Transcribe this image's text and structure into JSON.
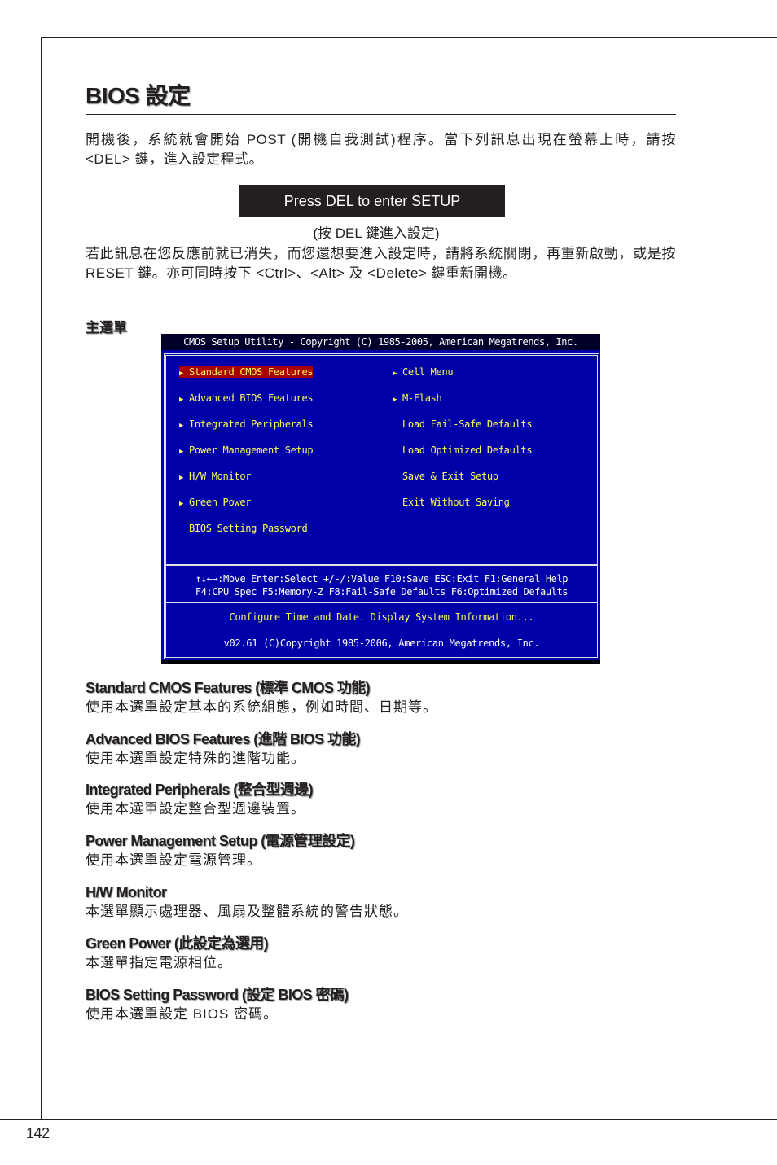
{
  "page": {
    "title": "BIOS 設定",
    "page_number": "142"
  },
  "intro": {
    "paragraph1": "開機後，系統就會開始 POST (開機自我測試)程序。當下列訊息出現在螢幕上時，請按 <DEL> 鍵，進入設定程式。",
    "press_box": "Press DEL to enter SETUP",
    "press_caption": "(按 DEL 鍵進入設定)",
    "paragraph2": "若此訊息在您反應前就已消失，而您還想要進入設定時，請將系統關閉，再重新啟動，或是按 RESET 鍵。亦可同時按下 <Ctrl>、<Alt> 及 <Delete> 鍵重新開機。"
  },
  "main_menu_heading": "主選單",
  "bios_screen": {
    "title": "CMOS Setup Utility - Copyright (C) 1985-2005, American Megatrends, Inc.",
    "left_items": [
      {
        "label": "Standard CMOS Features",
        "arrow": "▶",
        "selected": true
      },
      {
        "label": "Advanced BIOS Features",
        "arrow": "▶"
      },
      {
        "label": "Integrated Peripherals",
        "arrow": "▶"
      },
      {
        "label": "Power Management Setup",
        "arrow": "▶"
      },
      {
        "label": "H/W Monitor",
        "arrow": "▶"
      },
      {
        "label": "Green Power",
        "arrow": "▶"
      },
      {
        "label": "BIOS Setting Password",
        "arrow": ""
      }
    ],
    "right_items": [
      {
        "label": "Cell Menu",
        "arrow": "▶"
      },
      {
        "label": "M-Flash",
        "arrow": "▶"
      },
      {
        "label": "Load Fail-Safe Defaults",
        "arrow": ""
      },
      {
        "label": "Load Optimized Defaults",
        "arrow": ""
      },
      {
        "label": "Save & Exit Setup",
        "arrow": ""
      },
      {
        "label": "Exit Without Saving",
        "arrow": ""
      }
    ],
    "help_line1": "↑↓←→:Move  Enter:Select  +/-/:Value  F10:Save  ESC:Exit  F1:General Help",
    "help_line2": "F4:CPU Spec  F5:Memory-Z  F8:Fail-Safe Defaults  F6:Optimized Defaults",
    "description": "Configure Time and Date.  Display System Information...",
    "version": "v02.61 (C)Copyright 1985-2006, American Megatrends, Inc.",
    "colors": {
      "background": "#0000a8",
      "title_bar": "#00002a",
      "item_text": "#ffff55",
      "selected_bg": "#a80000",
      "help_text": "#ffffff"
    }
  },
  "sections": [
    {
      "heading": "Standard CMOS Features (標準 CMOS 功能)",
      "body": "使用本選單設定基本的系統組態，例如時間、日期等。"
    },
    {
      "heading": "Advanced BIOS Features (進階 BIOS 功能)",
      "body": "使用本選單設定特殊的進階功能。"
    },
    {
      "heading": "Integrated Peripherals (整合型週邊)",
      "body": "使用本選單設定整合型週邊裝置。"
    },
    {
      "heading": "Power Management Setup (電源管理設定)",
      "body": "使用本選單設定電源管理。"
    },
    {
      "heading": "H/W Monitor",
      "body": "本選單顯示處理器、風扇及整體系統的警告狀態。"
    },
    {
      "heading": "Green Power (此設定為選用)",
      "body": "本選單指定電源相位。"
    },
    {
      "heading": "BIOS Setting Password (設定 BIOS 密碼)",
      "body": "使用本選單設定 BIOS 密碼。"
    }
  ]
}
